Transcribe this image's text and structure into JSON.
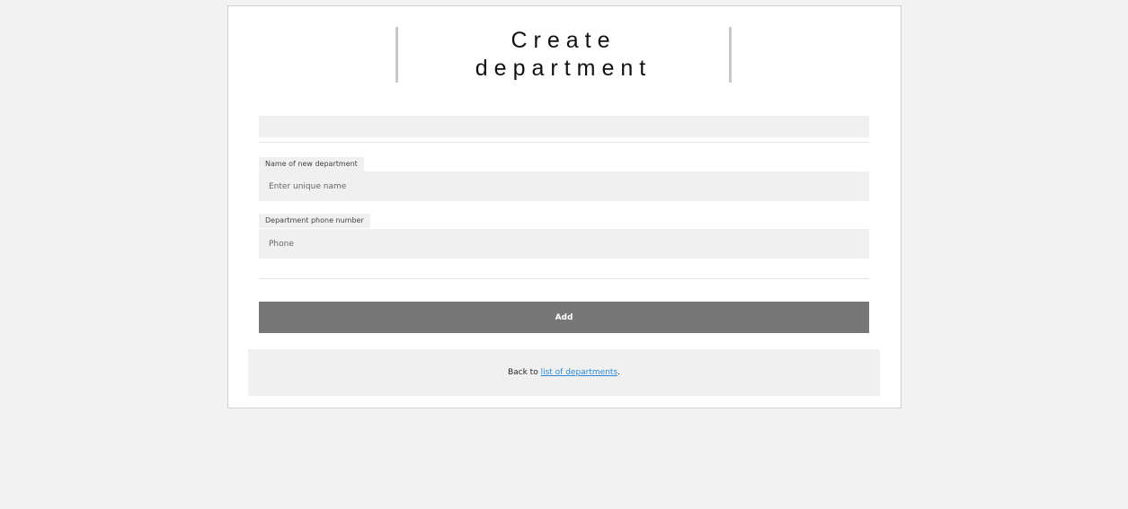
{
  "header": {
    "title_line1": "Create",
    "title_line2": "department"
  },
  "form": {
    "name_label": "Name of new department",
    "name_placeholder": "Enter unique name",
    "name_value": "",
    "phone_label": "Department phone number",
    "phone_placeholder": "Phone",
    "phone_value": "",
    "submit_label": "Add"
  },
  "footer": {
    "prefix": "Back to ",
    "link_text": "list of departments",
    "suffix": "."
  }
}
